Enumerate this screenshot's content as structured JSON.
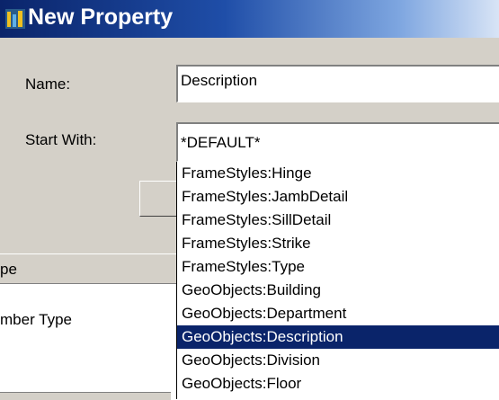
{
  "window": {
    "title": "New Property"
  },
  "form": {
    "name_label": "Name:",
    "name_value": "Description",
    "start_with_label": "Start With:",
    "start_with_value": "*DEFAULT*"
  },
  "background": {
    "column_header_fragment": "pe",
    "row_fragment": "mber Type"
  },
  "dropdown": {
    "selected_index": 7,
    "items": [
      "FrameStyles:Hinge",
      "FrameStyles:JambDetail",
      "FrameStyles:SillDetail",
      "FrameStyles:Strike",
      "FrameStyles:Type",
      "GeoObjects:Building",
      "GeoObjects:Department",
      "GeoObjects:Description",
      "GeoObjects:Division",
      "GeoObjects:Floor"
    ]
  },
  "colors": {
    "title_gradient_start": "#0a246a",
    "dialog_face": "#d4d0c8",
    "selection": "#0a246a"
  }
}
